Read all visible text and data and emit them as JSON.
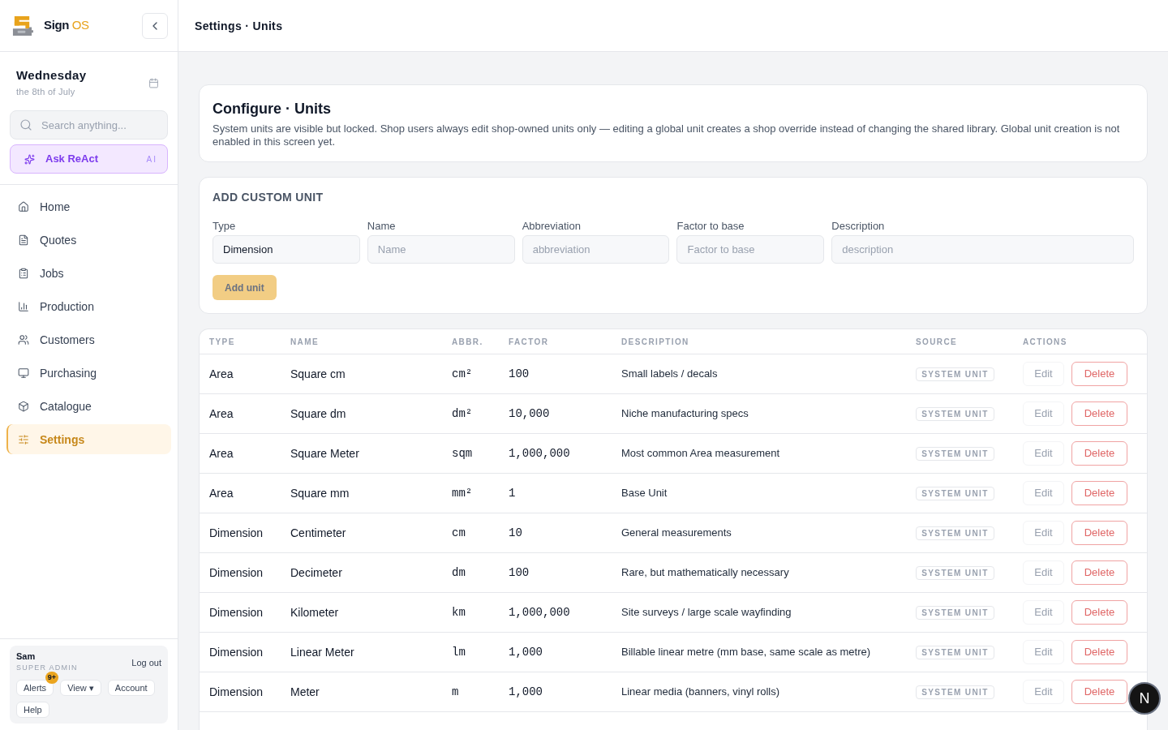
{
  "sidebar": {
    "brand": {
      "name": "Sign",
      "accent": "OS"
    },
    "date": {
      "day": "Wednesday",
      "date": "the 8th of July"
    },
    "search": {
      "placeholder": "Search anything..."
    },
    "assistant": {
      "label": "Ask ReAct",
      "badge": "AI"
    },
    "nav": [
      {
        "label": "Home",
        "selected": false
      },
      {
        "label": "Quotes",
        "selected": false
      },
      {
        "label": "Jobs",
        "selected": false
      },
      {
        "label": "Production",
        "selected": false
      },
      {
        "label": "Customers",
        "selected": false
      },
      {
        "label": "Purchasing",
        "selected": false
      },
      {
        "label": "Catalogue",
        "selected": false
      },
      {
        "label": "Settings",
        "selected": true
      }
    ],
    "user": {
      "name": "Sam",
      "role": "SUPER ADMIN",
      "logout": "Log out",
      "buttons": [
        {
          "label": "Alerts",
          "badge": "9+"
        },
        {
          "label": "View ▾"
        },
        {
          "label": "Account"
        },
        {
          "label": "Help"
        }
      ]
    }
  },
  "header": {
    "title": "Settings · Units"
  },
  "intro": {
    "title": "Configure · Units",
    "description": "System units are visible but locked. Shop users always edit shop-owned units only — editing a global unit creates a shop override instead of changing the shared library. Global unit creation is not enabled in this screen yet."
  },
  "form": {
    "title": "ADD CUSTOM UNIT",
    "fields": [
      {
        "label": "Type",
        "value": "Dimension"
      },
      {
        "label": "Name",
        "placeholder": "Name"
      },
      {
        "label": "Abbreviation",
        "placeholder": "abbreviation"
      },
      {
        "label": "Factor to base",
        "placeholder": "Factor to base"
      },
      {
        "label": "Description",
        "placeholder": "description"
      }
    ],
    "submit": {
      "label": "Add unit",
      "disabled": true
    }
  },
  "table": {
    "columns": [
      "TYPE",
      "NAME",
      "ABBR.",
      "FACTOR",
      "DESCRIPTION",
      "SOURCE",
      "ACTIONS"
    ],
    "rows": [
      {
        "type": "Area",
        "name": "Square cm",
        "abbr": "cm²",
        "factor": "100",
        "description": "Small labels / decals",
        "source": "SYSTEM UNIT",
        "edit": {
          "label": "Edit",
          "disabled": true
        },
        "delete": {
          "label": "Delete",
          "disabled": false
        }
      },
      {
        "type": "Area",
        "name": "Square dm",
        "abbr": "dm²",
        "factor": "10,000",
        "description": "Niche manufacturing specs",
        "source": "SYSTEM UNIT",
        "edit": {
          "label": "Edit",
          "disabled": true
        },
        "delete": {
          "label": "Delete",
          "disabled": false
        }
      },
      {
        "type": "Area",
        "name": "Square Meter",
        "abbr": "sqm",
        "factor": "1,000,000",
        "description": "Most common Area measurement",
        "source": "SYSTEM UNIT",
        "edit": {
          "label": "Edit",
          "disabled": true
        },
        "delete": {
          "label": "Delete",
          "disabled": false
        }
      },
      {
        "type": "Area",
        "name": "Square mm",
        "abbr": "mm²",
        "factor": "1",
        "description": "Base Unit",
        "source": "SYSTEM UNIT",
        "edit": {
          "label": "Edit",
          "disabled": true
        },
        "delete": {
          "label": "Delete",
          "disabled": false
        }
      },
      {
        "type": "Dimension",
        "name": "Centimeter",
        "abbr": "cm",
        "factor": "10",
        "description": "General measurements",
        "source": "SYSTEM UNIT",
        "edit": {
          "label": "Edit",
          "disabled": true
        },
        "delete": {
          "label": "Delete",
          "disabled": false
        }
      },
      {
        "type": "Dimension",
        "name": "Decimeter",
        "abbr": "dm",
        "factor": "100",
        "description": "Rare, but mathematically necessary",
        "source": "SYSTEM UNIT",
        "edit": {
          "label": "Edit",
          "disabled": true
        },
        "delete": {
          "label": "Delete",
          "disabled": false
        }
      },
      {
        "type": "Dimension",
        "name": "Kilometer",
        "abbr": "km",
        "factor": "1,000,000",
        "description": "Site surveys / large scale wayfinding",
        "source": "SYSTEM UNIT",
        "edit": {
          "label": "Edit",
          "disabled": true
        },
        "delete": {
          "label": "Delete",
          "disabled": false
        }
      },
      {
        "type": "Dimension",
        "name": "Linear Meter",
        "abbr": "lm",
        "factor": "1,000",
        "description": "Billable linear metre (mm base, same scale as metre)",
        "source": "SYSTEM UNIT",
        "edit": {
          "label": "Edit",
          "disabled": true
        },
        "delete": {
          "label": "Delete",
          "disabled": false
        }
      },
      {
        "type": "Dimension",
        "name": "Meter",
        "abbr": "m",
        "factor": "1,000",
        "description": "Linear media (banners, vinyl rolls)",
        "source": "SYSTEM UNIT",
        "edit": {
          "label": "Edit",
          "disabled": true
        },
        "delete": {
          "label": "Delete",
          "disabled": false
        }
      }
    ]
  },
  "dev_indicator": {
    "label": "N"
  }
}
